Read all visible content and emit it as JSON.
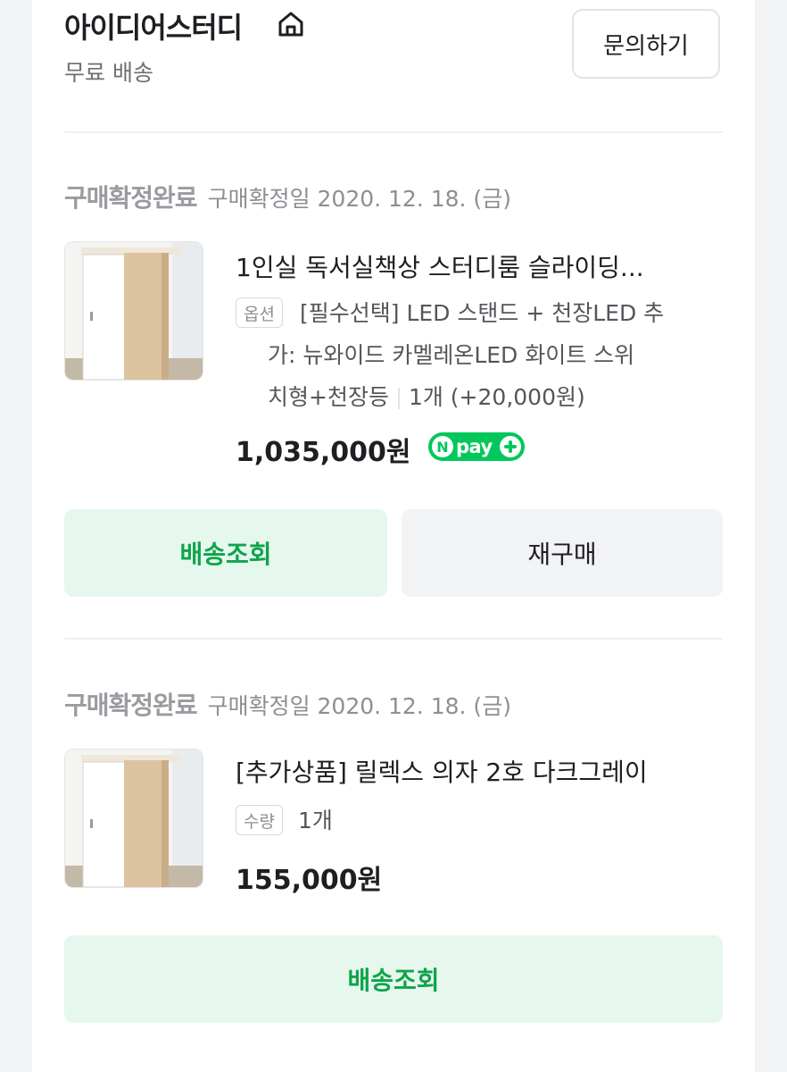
{
  "store": {
    "name": "아이디어스터디",
    "shipping": "무료 배송",
    "inquiry_label": "문의하기"
  },
  "orders": [
    {
      "status": "구매확정완료",
      "confirm_date": "구매확정일 2020. 12. 18. (금)",
      "title": "1인실 독서실책상 스터디룸 슬라이딩...",
      "badge": "옵션",
      "option_line1": "[필수선택] LED 스탠드 + 천장LED 추",
      "option_line2": "가: 뉴와이드 카멜레온LED 화이트 스위",
      "option_line3": "치형+천장등",
      "option_qty": "1개 (+20,000원)",
      "price": "1,035,000원",
      "npay_n": "N",
      "npay_text": "pay",
      "buttons": {
        "track": "배송조회",
        "reorder": "재구매"
      }
    },
    {
      "status": "구매확정완료",
      "confirm_date": "구매확정일 2020. 12. 18. (금)",
      "title": "[추가상품] 릴렉스 의자 2호 다크그레이",
      "badge": "수량",
      "qty": "1개",
      "price": "155,000원",
      "buttons": {
        "track": "배송조회"
      }
    }
  ],
  "icons": [
    "home-icon",
    "product-thumbnail",
    "npay-logo"
  ],
  "colors": {
    "accent_green": "#0fa44a",
    "button_green_bg": "#e6f7ee",
    "npay_green": "#03c75a"
  }
}
